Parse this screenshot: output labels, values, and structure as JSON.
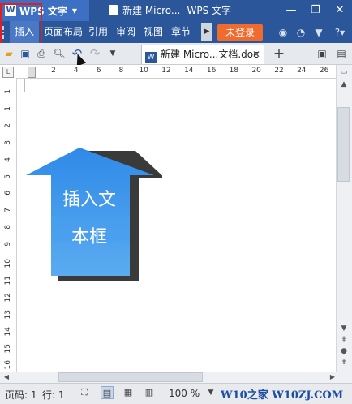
{
  "titlebar": {
    "app_name": "WPS 文字",
    "document_title": "新建 Micro...- WPS 文字"
  },
  "menu": {
    "items": [
      "插入",
      "页面布局",
      "引用",
      "审阅",
      "视图",
      "章节"
    ],
    "login_label": "未登录",
    "help_label": "?"
  },
  "toolbar": {
    "tab_label": "新建 Micro...文档.doc *",
    "add_tab": "+"
  },
  "ruler": {
    "h_numbers": [
      "2",
      "4",
      "6",
      "8",
      "10",
      "12",
      "14",
      "16",
      "18",
      "20",
      "22",
      "24",
      "26"
    ],
    "v_numbers": [
      "1",
      "1",
      "2",
      "3",
      "4",
      "5",
      "6",
      "7",
      "8",
      "9",
      "10",
      "11",
      "12",
      "13",
      "14",
      "15",
      "16"
    ]
  },
  "shape": {
    "line1": "插入文",
    "line2": "本框",
    "colors": {
      "fill_top": "#2f8ae8",
      "fill_bottom": "#5aabf0",
      "shadow": "#3a3a3a"
    }
  },
  "statusbar": {
    "page": "页码: 1",
    "line": "行: 1",
    "zoom": "100 %",
    "watermark": "W10之家 W10ZJ.COM"
  },
  "colors": {
    "titlebar": "#2b579a",
    "login": "#f06b2e",
    "highlight": "#e02020"
  }
}
